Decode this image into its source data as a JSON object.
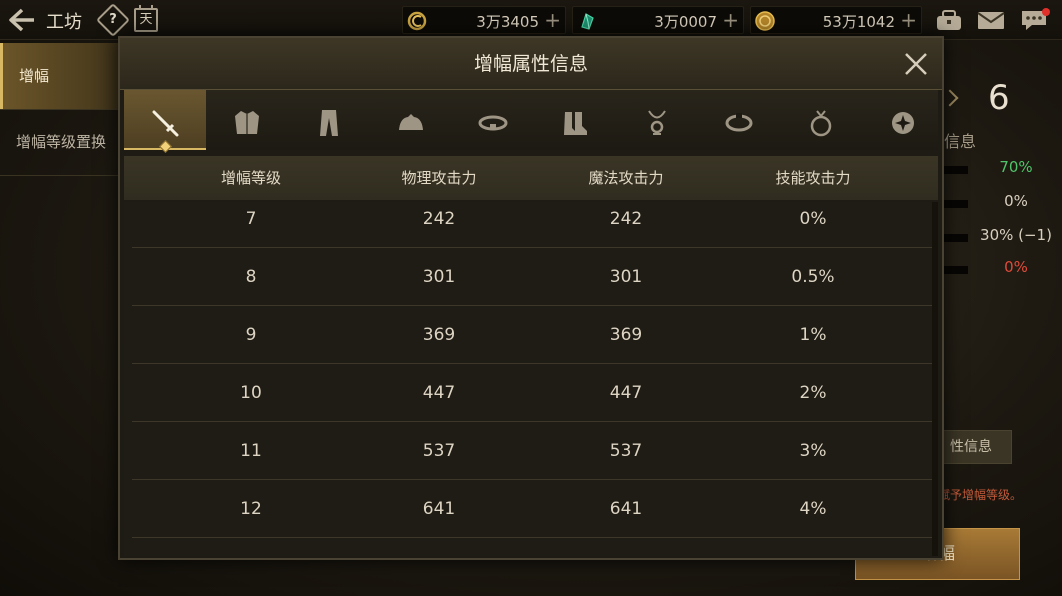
{
  "topbar": {
    "title": "工坊",
    "help_icon_glyph": "?",
    "calendar_icon_glyph": "天",
    "currencies": [
      {
        "name": "cera-point-icon",
        "value": "3万3405",
        "color": "#c9a441"
      },
      {
        "name": "crystal-icon",
        "value": "3万0007",
        "color": "#2fb38a"
      },
      {
        "name": "gold-coin-icon",
        "value": "53万1042",
        "color": "#d7a93a"
      }
    ],
    "plus": "+"
  },
  "sidebar": {
    "items": [
      {
        "label": "增幅",
        "active": true
      },
      {
        "label": "增幅等级置换",
        "active": false
      }
    ]
  },
  "background_panel": {
    "level": "6",
    "subtitle": "信息",
    "stats": [
      {
        "value": "70%",
        "color": "#4fc46a"
      },
      {
        "value": "0%",
        "color": "#d8cfbf"
      },
      {
        "value": "30% (−1)",
        "color": "#d8cfbf"
      },
      {
        "value": "0%",
        "color": "#e04a3a"
      }
    ],
    "info_button": "性信息",
    "hint": "赋予增幅等级。",
    "enhance_button": "增幅"
  },
  "modal": {
    "title": "增幅属性信息",
    "close_icon": "close-icon",
    "tabs": [
      {
        "icon": "weapon-icon",
        "active": true
      },
      {
        "icon": "top-armor-icon",
        "active": false
      },
      {
        "icon": "bottom-armor-icon",
        "active": false
      },
      {
        "icon": "shoulder-armor-icon",
        "active": false
      },
      {
        "icon": "belt-icon",
        "active": false
      },
      {
        "icon": "shoes-icon",
        "active": false
      },
      {
        "icon": "necklace-icon",
        "active": false
      },
      {
        "icon": "bracelet-icon",
        "active": false
      },
      {
        "icon": "ring-icon",
        "active": false
      },
      {
        "icon": "special-equipment-icon",
        "active": false
      }
    ],
    "table": {
      "headers": [
        "增幅等级",
        "物理攻击力",
        "魔法攻击力",
        "技能攻击力"
      ],
      "rows": [
        [
          "7",
          "242",
          "242",
          "0%"
        ],
        [
          "8",
          "301",
          "301",
          "0.5%"
        ],
        [
          "9",
          "369",
          "369",
          "1%"
        ],
        [
          "10",
          "447",
          "447",
          "2%"
        ],
        [
          "11",
          "537",
          "537",
          "3%"
        ],
        [
          "12",
          "641",
          "641",
          "4%"
        ]
      ]
    }
  }
}
